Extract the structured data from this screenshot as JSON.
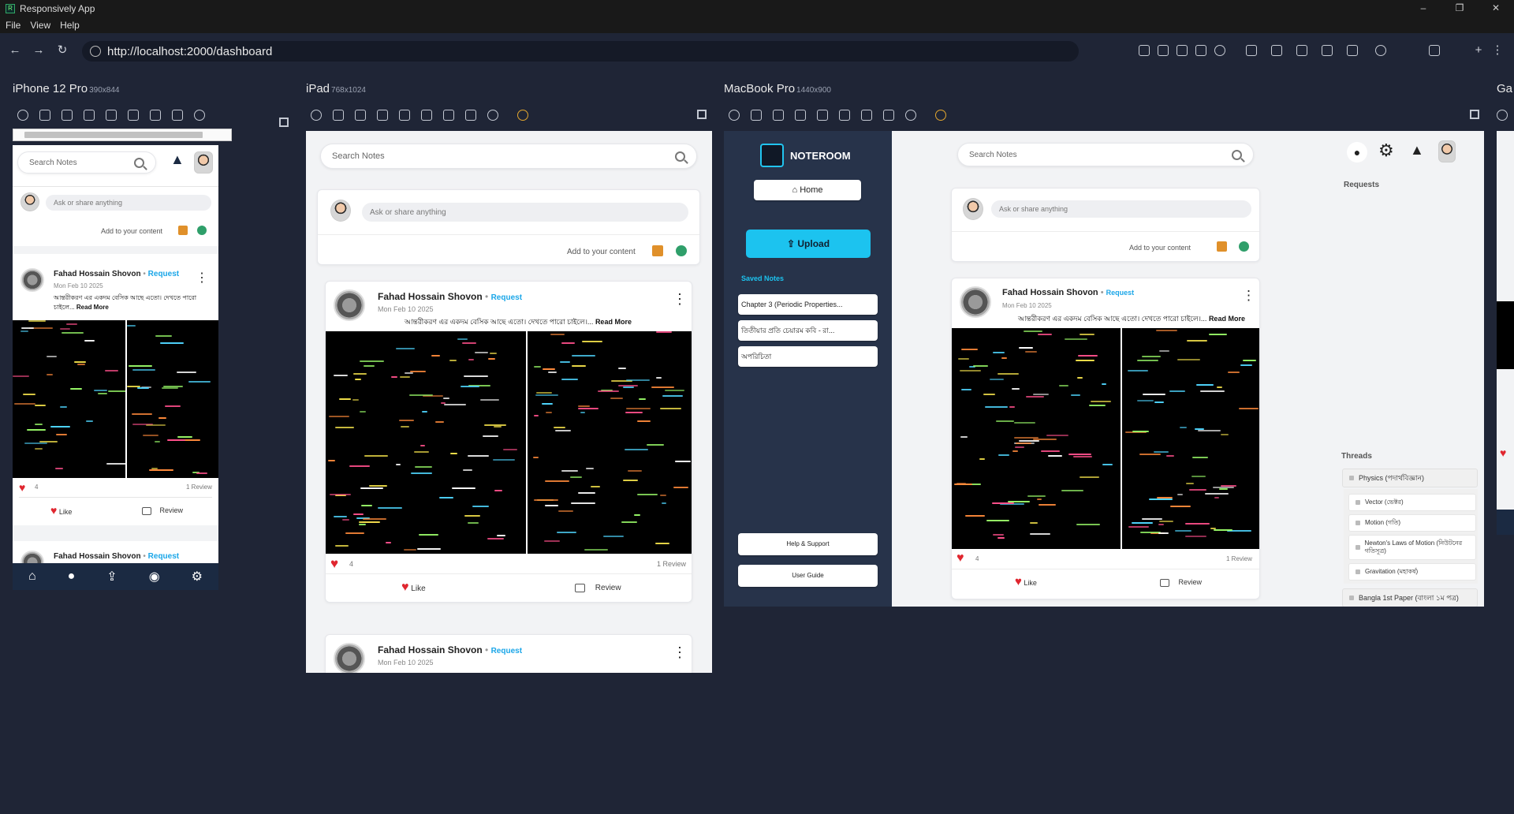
{
  "window": {
    "title": "Responsively App",
    "icon_text": "R",
    "controls": [
      "–",
      "❐",
      "✕"
    ]
  },
  "menu": [
    "File",
    "View",
    "Help"
  ],
  "nav": {
    "url": "http://localhost:2000/dashboard",
    "back": "←",
    "forward": "→",
    "reload": "↻",
    "add": "+",
    "more": "⋮"
  },
  "devices": {
    "iphone": {
      "name": "iPhone 12 Pro",
      "size": "390x844"
    },
    "ipad": {
      "name": "iPad",
      "size": "768x1024"
    },
    "macbook": {
      "name": "MacBook Pro",
      "size": "1440x900"
    },
    "galaxy": {
      "name": "Ga"
    }
  },
  "app": {
    "brand": "NOTEROOM",
    "search_placeholder": "Search Notes",
    "ask_placeholder": "Ask or share anything",
    "add_content": "Add to your content",
    "home": "Home",
    "upload": "Upload",
    "saved_notes_title": "Saved Notes",
    "saved_notes": [
      "Chapter 3 (Periodic Properties...",
      "তিতীয়ার প্রতি চেয়ারম কবি - রা...",
      "অপরিচিতা"
    ],
    "help": "Help & Support",
    "guide": "User Guide",
    "requests": "Requests",
    "threads_title": "Threads",
    "threads_parent": "Physics (পদার্থবিজ্ঞান)",
    "threads": [
      "Vector (ভেক্টর)",
      "Motion (গতি)",
      "Newton's Laws of Motion (নিউটনের গতিসূত্র)",
      "Gravitation (মহাকর্ষ)"
    ],
    "threads_next": "Bangla 1st Paper (বাংলা ১ম পত্র)"
  },
  "post": {
    "author": "Fahad Hossain Shovon",
    "separator": "•",
    "request": "Request",
    "date": "Mon Feb 10 2025",
    "text": "আন্তরীকরণ এর একদম বেসিক আছে এতো। দেখতে পারো চাইলে।...",
    "text_short": "আন্তরীকরণ এর একদম বেসিক আছে এতো। দেখতে পারো চাইলে...",
    "read_more": "Read More",
    "likes": "4",
    "reviews": "1 Review",
    "like": "Like",
    "review": "Review"
  },
  "icons": {
    "heart": "♥",
    "bell": "🔔",
    "gear": "⚙",
    "kebab": "⋮",
    "home": "⌂",
    "upload": "⇪"
  }
}
